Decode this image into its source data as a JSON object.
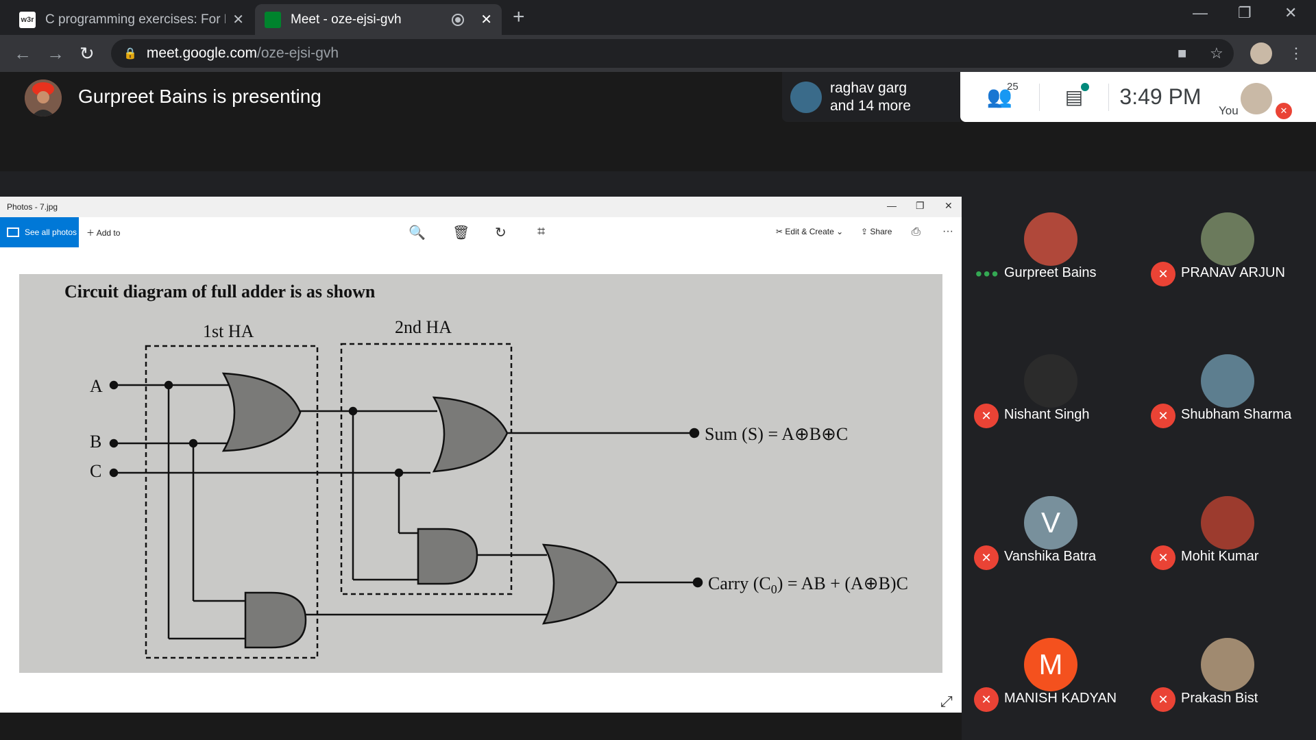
{
  "browser": {
    "tabs": [
      {
        "favicon": "w3r",
        "title": "C programming exercises: For Lo",
        "active": false
      },
      {
        "favicon": "meet-logo",
        "title": "Meet - oze-ejsi-gvh",
        "active": true
      }
    ],
    "url_host": "meet.google.com",
    "url_path": "/oze-ejsi-gvh"
  },
  "meet": {
    "presenting_text": "Gurpreet Bains is presenting",
    "other_viewers_line1": "raghav garg",
    "other_viewers_line2": "and 14 more",
    "people_count": "25",
    "time": "3:49 PM",
    "you_label": "You"
  },
  "photos": {
    "window_title": "Photos - 7.jpg",
    "see_all": "See all photos",
    "add_to": "Add to",
    "edit_create": "Edit & Create",
    "share": "Share"
  },
  "diagram": {
    "title": "Circuit diagram of full adder is as shown",
    "label_ha1": "1st HA",
    "label_ha2": "2nd HA",
    "input_a": "A",
    "input_b": "B",
    "input_c": "C",
    "sum_label": "Sum (S) = A⊕B⊕C",
    "carry_label": "Carry (C",
    "carry_sub": "0",
    "carry_rest": ") = AB + (A⊕B)C"
  },
  "participants": [
    {
      "name": "Gurpreet Bains",
      "status": "speaking",
      "avatar": "photo",
      "color": "#b0483a"
    },
    {
      "name": "PRANAV ARJUN",
      "status": "muted",
      "avatar": "photo",
      "color": "#6b7a5c"
    },
    {
      "name": "Nishant Singh",
      "status": "muted",
      "avatar": "photo",
      "color": "#2b2b2b"
    },
    {
      "name": "Shubham Sharma",
      "status": "muted",
      "avatar": "photo",
      "color": "#5d7e8f"
    },
    {
      "name": "Vanshika Batra",
      "status": "muted",
      "avatar": "V",
      "color": "#78909c"
    },
    {
      "name": "Mohit Kumar",
      "status": "muted",
      "avatar": "photo",
      "color": "#9c3b2e"
    },
    {
      "name": "MANISH KADYAN",
      "status": "muted",
      "avatar": "M",
      "color": "#f4511e"
    },
    {
      "name": "Prakash Bist",
      "status": "muted",
      "avatar": "photo",
      "color": "#a08a70"
    }
  ]
}
